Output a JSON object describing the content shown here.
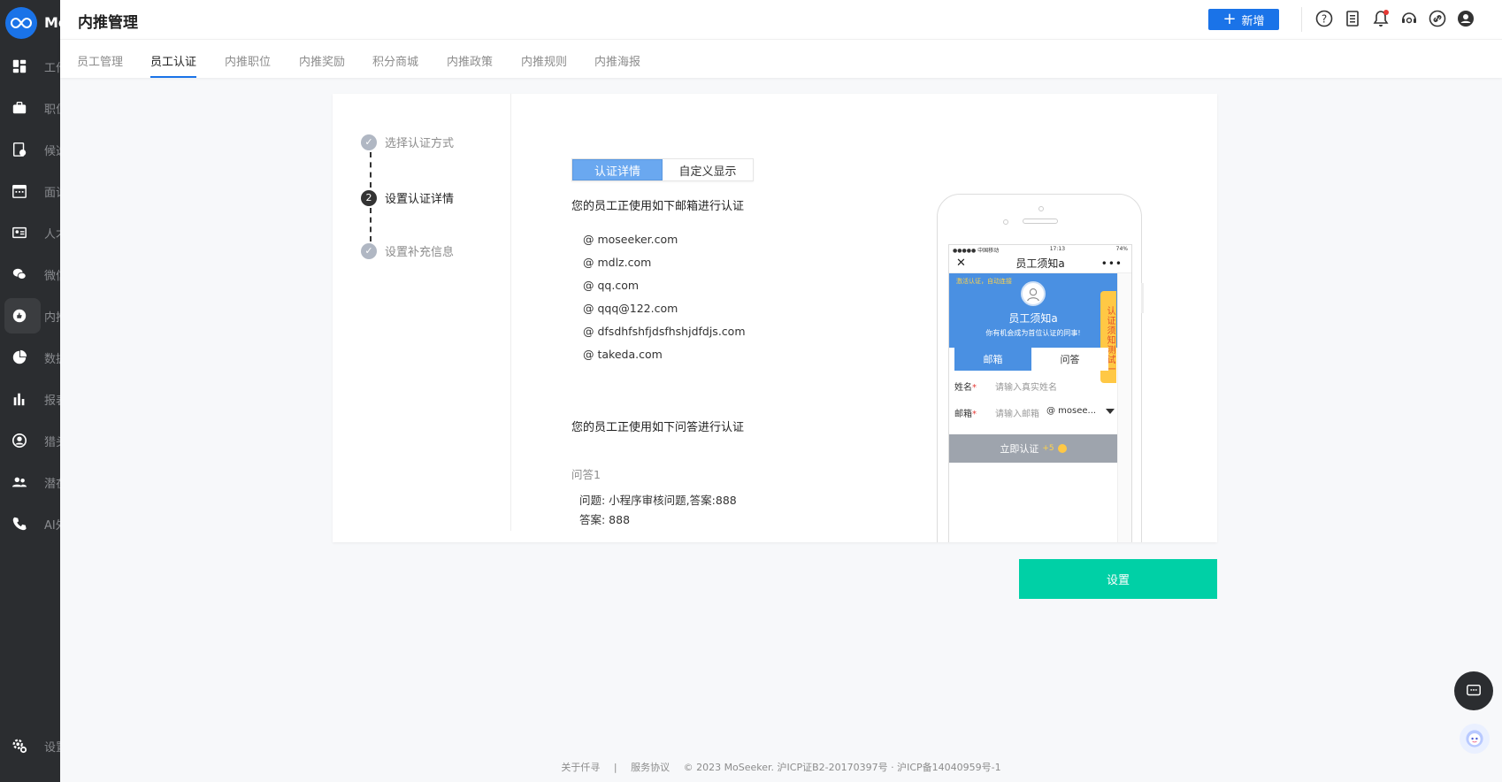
{
  "app": {
    "logo_text": "Mo",
    "logo_caption": "MoSeeker"
  },
  "sidebar": {
    "items": [
      {
        "icon": "dashboard-icon",
        "label": "工作台"
      },
      {
        "icon": "briefcase-icon",
        "label": "职位"
      },
      {
        "icon": "candidate-icon",
        "label": "候选人"
      },
      {
        "icon": "calendar-icon",
        "label": "面试"
      },
      {
        "icon": "id-card-icon",
        "label": "人才"
      },
      {
        "icon": "wechat-icon",
        "label": "微信"
      },
      {
        "icon": "referral-icon",
        "label": "内推"
      },
      {
        "icon": "pie-chart-icon",
        "label": "数据"
      },
      {
        "icon": "bar-chart-icon",
        "label": "报表"
      },
      {
        "icon": "headhunter-icon",
        "label": "猎头"
      },
      {
        "icon": "people-icon",
        "label": "潜在"
      },
      {
        "icon": "phone-icon",
        "label": "AI外呼"
      }
    ],
    "settings": {
      "icon": "settings-icon",
      "label": "设置"
    }
  },
  "header": {
    "title": "内推管理",
    "add_label": "新增",
    "icons": [
      "help-icon",
      "document-icon",
      "bell-icon",
      "support-icon",
      "link-icon",
      "user-avatar-icon"
    ],
    "accent": "#1a73e8"
  },
  "tabs": [
    {
      "label": "员工管理"
    },
    {
      "label": "员工认证"
    },
    {
      "label": "内推职位"
    },
    {
      "label": "内推奖励"
    },
    {
      "label": "积分商城"
    },
    {
      "label": "内推政策"
    },
    {
      "label": "内推规则"
    },
    {
      "label": "内推海报"
    }
  ],
  "steps": [
    {
      "label": "选择认证方式",
      "state": "done"
    },
    {
      "label": "设置认证详情",
      "state": "current",
      "number": "2"
    },
    {
      "label": "设置补充信息",
      "state": "done"
    }
  ],
  "segmented": {
    "active": "认证详情",
    "other": "自定义显示"
  },
  "email_section": {
    "title": "您的员工正使用如下邮箱进行认证",
    "domains": [
      "@ moseeker.com",
      "@ mdlz.com",
      "@ qq.com",
      "@ qqq@122.com",
      "@ dfsdhfshfjdsfhshjdfdjs.com",
      "@ takeda.com"
    ]
  },
  "qa_section": {
    "title": "您的员工正使用如下问答进行认证",
    "label": "问答1",
    "question": "问题: 小程序审核问题,答案:888",
    "answer": "答案: 888"
  },
  "phone": {
    "status_left": "●●●●● 中国移动 ",
    "status_time": "17:13",
    "status_right": "74%",
    "nav_title": "员工须知a",
    "band_tip": "激活认证，自动连接",
    "band_name": "员工须知a",
    "band_sub": "你有机会成为首位认证的同事!",
    "vertical_tab": "认证须知测试一",
    "tab_email": "邮箱",
    "tab_qa": "问答",
    "name_label": "姓名",
    "name_placeholder": "请输入真实姓名",
    "email_label": "邮箱",
    "email_placeholder": "请输入邮箱",
    "email_domain": "@ mosee...",
    "verify_label": "立即认证",
    "verify_points": "+5"
  },
  "set_button": "设置",
  "footer": {
    "about": "关于仟寻",
    "sep": "|",
    "terms": "服务协议",
    "copyright": "© 2023 MoSeeker. 沪ICP证B2-20170397号 · 沪ICP备14040959号-1"
  },
  "colors": {
    "primary": "#1a73e8",
    "teal": "#00d0a6",
    "sidebar": "#2b2d30"
  }
}
